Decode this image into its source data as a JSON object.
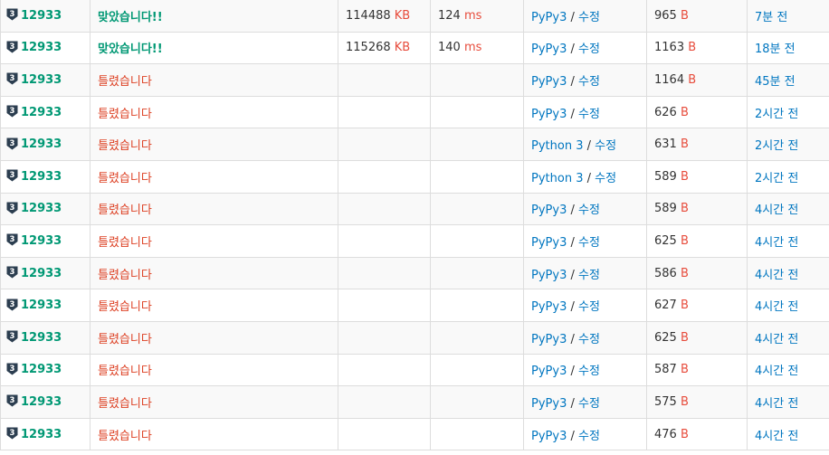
{
  "colors": {
    "accepted": "#009874",
    "wrong": "#dd4124",
    "unit": "#e74c3c",
    "link": "#0076c0",
    "tier_icon": "#2c3e50"
  },
  "tier_icon": {
    "name": "silver-tier-icon",
    "label": "3"
  },
  "rows": [
    {
      "problem": "12933",
      "result": "맞았습니다!!",
      "memory": "114488",
      "memory_unit": "KB",
      "time": "124",
      "time_unit": "ms",
      "language": "PyPy3",
      "edit": "수정",
      "length": "965",
      "length_unit": "B",
      "submitted": "7분 전"
    },
    {
      "problem": "12933",
      "result": "맞았습니다!!",
      "memory": "115268",
      "memory_unit": "KB",
      "time": "140",
      "time_unit": "ms",
      "language": "PyPy3",
      "edit": "수정",
      "length": "1163",
      "length_unit": "B",
      "submitted": "18분 전"
    },
    {
      "problem": "12933",
      "result": "틀렸습니다",
      "memory": "",
      "memory_unit": "",
      "time": "",
      "time_unit": "",
      "language": "PyPy3",
      "edit": "수정",
      "length": "1164",
      "length_unit": "B",
      "submitted": "45분 전"
    },
    {
      "problem": "12933",
      "result": "틀렸습니다",
      "memory": "",
      "memory_unit": "",
      "time": "",
      "time_unit": "",
      "language": "PyPy3",
      "edit": "수정",
      "length": "626",
      "length_unit": "B",
      "submitted": "2시간 전"
    },
    {
      "problem": "12933",
      "result": "틀렸습니다",
      "memory": "",
      "memory_unit": "",
      "time": "",
      "time_unit": "",
      "language": "Python 3",
      "edit": "수정",
      "length": "631",
      "length_unit": "B",
      "submitted": "2시간 전"
    },
    {
      "problem": "12933",
      "result": "틀렸습니다",
      "memory": "",
      "memory_unit": "",
      "time": "",
      "time_unit": "",
      "language": "Python 3",
      "edit": "수정",
      "length": "589",
      "length_unit": "B",
      "submitted": "2시간 전"
    },
    {
      "problem": "12933",
      "result": "틀렸습니다",
      "memory": "",
      "memory_unit": "",
      "time": "",
      "time_unit": "",
      "language": "PyPy3",
      "edit": "수정",
      "length": "589",
      "length_unit": "B",
      "submitted": "4시간 전"
    },
    {
      "problem": "12933",
      "result": "틀렸습니다",
      "memory": "",
      "memory_unit": "",
      "time": "",
      "time_unit": "",
      "language": "PyPy3",
      "edit": "수정",
      "length": "625",
      "length_unit": "B",
      "submitted": "4시간 전"
    },
    {
      "problem": "12933",
      "result": "틀렸습니다",
      "memory": "",
      "memory_unit": "",
      "time": "",
      "time_unit": "",
      "language": "PyPy3",
      "edit": "수정",
      "length": "586",
      "length_unit": "B",
      "submitted": "4시간 전"
    },
    {
      "problem": "12933",
      "result": "틀렸습니다",
      "memory": "",
      "memory_unit": "",
      "time": "",
      "time_unit": "",
      "language": "PyPy3",
      "edit": "수정",
      "length": "627",
      "length_unit": "B",
      "submitted": "4시간 전"
    },
    {
      "problem": "12933",
      "result": "틀렸습니다",
      "memory": "",
      "memory_unit": "",
      "time": "",
      "time_unit": "",
      "language": "PyPy3",
      "edit": "수정",
      "length": "625",
      "length_unit": "B",
      "submitted": "4시간 전"
    },
    {
      "problem": "12933",
      "result": "틀렸습니다",
      "memory": "",
      "memory_unit": "",
      "time": "",
      "time_unit": "",
      "language": "PyPy3",
      "edit": "수정",
      "length": "587",
      "length_unit": "B",
      "submitted": "4시간 전"
    },
    {
      "problem": "12933",
      "result": "틀렸습니다",
      "memory": "",
      "memory_unit": "",
      "time": "",
      "time_unit": "",
      "language": "PyPy3",
      "edit": "수정",
      "length": "575",
      "length_unit": "B",
      "submitted": "4시간 전"
    },
    {
      "problem": "12933",
      "result": "틀렸습니다",
      "memory": "",
      "memory_unit": "",
      "time": "",
      "time_unit": "",
      "language": "PyPy3",
      "edit": "수정",
      "length": "476",
      "length_unit": "B",
      "submitted": "4시간 전"
    }
  ]
}
